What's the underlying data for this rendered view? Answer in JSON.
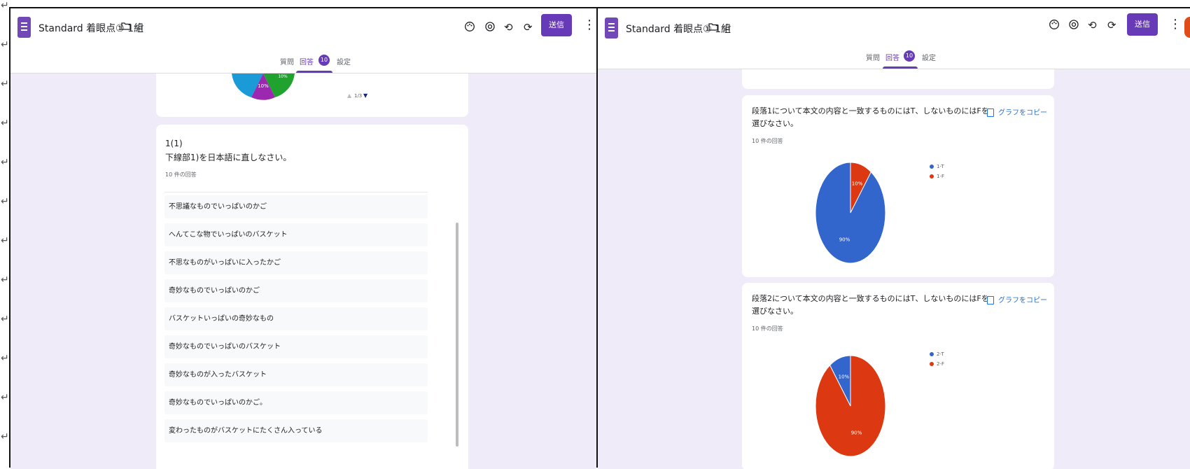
{
  "left": {
    "title": "Standard 着眼点① 1組",
    "tabs": [
      {
        "label": "質問"
      },
      {
        "label": "回答"
      },
      {
        "label": "設定"
      }
    ],
    "response_count": "10",
    "send_label": "送信",
    "top_chart": {
      "slice_labels": [
        "10%",
        "10%"
      ],
      "pager": "1/3",
      "colors": [
        "#1a9ad6",
        "#9c27b0",
        "#1fa22e"
      ]
    },
    "question": {
      "number": "1(1)",
      "text": "下線部1)を日本語に直しなさい。",
      "count_text": "10 件の回答",
      "responses": [
        "不思議なものでいっぱいのかご",
        "へんてこな物でいっぱいのバスケット",
        "不思なものがいっぱいに入ったかご",
        "奇妙なものでいっぱいのかご",
        "バスケットいっぱいの奇妙なもの",
        "奇妙なものでいっぱいのバスケット",
        "奇妙なものが入ったバスケット",
        "奇妙なものでいっぱいのかご。",
        "変わったものがバスケットにたくさん入っている"
      ]
    }
  },
  "right": {
    "title": "Standard 着眼点① 1組",
    "tabs": [
      {
        "label": "質問"
      },
      {
        "label": "回答"
      },
      {
        "label": "設定"
      }
    ],
    "response_count": "10",
    "send_label": "送信",
    "copy_label": "グラフをコピー",
    "charts": [
      {
        "question": "段落1について本文の内容と一致するものにはT、しないものにはFを選びなさい。",
        "count_text": "10 件の回答",
        "chart_data": {
          "type": "pie",
          "categories": [
            "1-T",
            "1-F"
          ],
          "values": [
            90,
            10
          ],
          "labels": [
            "90%",
            "10%"
          ],
          "colors": [
            "#3366cc",
            "#dc3912"
          ]
        }
      },
      {
        "question": "段落2について本文の内容と一致するものにはT、しないものにはFを選びなさい。",
        "count_text": "10 件の回答",
        "chart_data": {
          "type": "pie",
          "categories": [
            "2-T",
            "2-F"
          ],
          "values": [
            10,
            90
          ],
          "labels": [
            "10%",
            "90%"
          ],
          "colors": [
            "#3366cc",
            "#dc3912"
          ]
        }
      }
    ]
  },
  "icons": [
    "palette-icon",
    "preview-icon",
    "undo-icon",
    "redo-icon",
    "more-vert-icon",
    "folder-icon",
    "star-icon",
    "copy-icon"
  ]
}
